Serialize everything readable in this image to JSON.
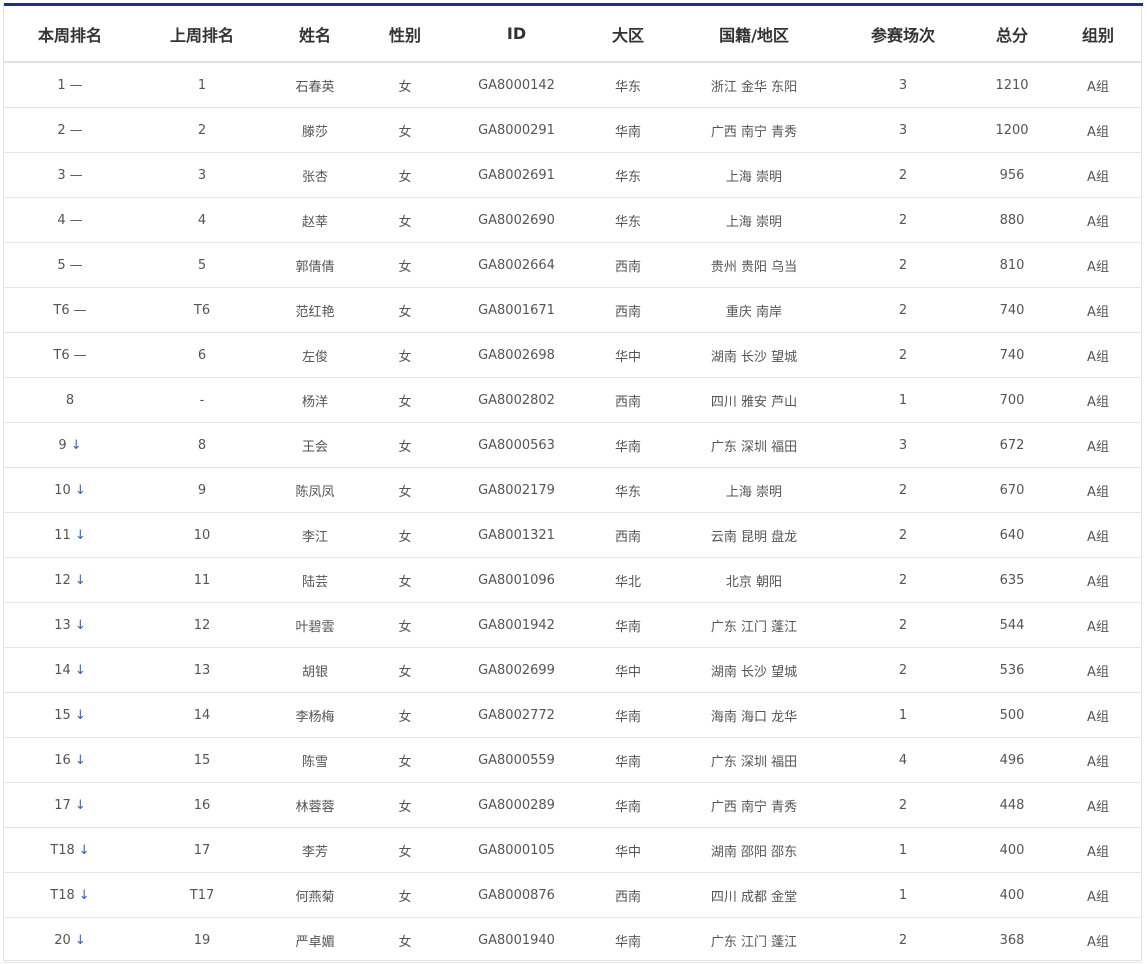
{
  "colors": {
    "top_bar": "#1c3185",
    "down_arrow": "#2b5fd9"
  },
  "headers": [
    "本周排名",
    "上周排名",
    "姓名",
    "性别",
    "ID",
    "大区",
    "国籍/地区",
    "参赛场次",
    "总分",
    "组别"
  ],
  "rows": [
    {
      "rank": "1",
      "trend": "—",
      "last": "1",
      "name": "石春英",
      "gender": "女",
      "id": "GA8000142",
      "region": "华东",
      "location": "浙江 金华 东阳",
      "games": "3",
      "score": "1210",
      "group": "A组"
    },
    {
      "rank": "2",
      "trend": "—",
      "last": "2",
      "name": "滕莎",
      "gender": "女",
      "id": "GA8000291",
      "region": "华南",
      "location": "广西 南宁 青秀",
      "games": "3",
      "score": "1200",
      "group": "A组"
    },
    {
      "rank": "3",
      "trend": "—",
      "last": "3",
      "name": "张杏",
      "gender": "女",
      "id": "GA8002691",
      "region": "华东",
      "location": "上海 崇明",
      "games": "2",
      "score": "956",
      "group": "A组"
    },
    {
      "rank": "4",
      "trend": "—",
      "last": "4",
      "name": "赵莘",
      "gender": "女",
      "id": "GA8002690",
      "region": "华东",
      "location": "上海 崇明",
      "games": "2",
      "score": "880",
      "group": "A组"
    },
    {
      "rank": "5",
      "trend": "—",
      "last": "5",
      "name": "郭倩倩",
      "gender": "女",
      "id": "GA8002664",
      "region": "西南",
      "location": "贵州 贵阳 乌当",
      "games": "2",
      "score": "810",
      "group": "A组"
    },
    {
      "rank": "T6",
      "trend": "—",
      "last": "T6",
      "name": "范红艳",
      "gender": "女",
      "id": "GA8001671",
      "region": "西南",
      "location": "重庆 南岸",
      "games": "2",
      "score": "740",
      "group": "A组"
    },
    {
      "rank": "T6",
      "trend": "—",
      "last": "6",
      "name": "左俊",
      "gender": "女",
      "id": "GA8002698",
      "region": "华中",
      "location": "湖南 长沙 望城",
      "games": "2",
      "score": "740",
      "group": "A组"
    },
    {
      "rank": "8",
      "trend": "",
      "last": "-",
      "name": "杨洋",
      "gender": "女",
      "id": "GA8002802",
      "region": "西南",
      "location": "四川 雅安 芦山",
      "games": "1",
      "score": "700",
      "group": "A组"
    },
    {
      "rank": "9",
      "trend": "↓",
      "last": "8",
      "name": "王会",
      "gender": "女",
      "id": "GA8000563",
      "region": "华南",
      "location": "广东 深圳 福田",
      "games": "3",
      "score": "672",
      "group": "A组"
    },
    {
      "rank": "10",
      "trend": "↓",
      "last": "9",
      "name": "陈凤凤",
      "gender": "女",
      "id": "GA8002179",
      "region": "华东",
      "location": "上海 崇明",
      "games": "2",
      "score": "670",
      "group": "A组"
    },
    {
      "rank": "11",
      "trend": "↓",
      "last": "10",
      "name": "李江",
      "gender": "女",
      "id": "GA8001321",
      "region": "西南",
      "location": "云南 昆明 盘龙",
      "games": "2",
      "score": "640",
      "group": "A组"
    },
    {
      "rank": "12",
      "trend": "↓",
      "last": "11",
      "name": "陆芸",
      "gender": "女",
      "id": "GA8001096",
      "region": "华北",
      "location": "北京 朝阳",
      "games": "2",
      "score": "635",
      "group": "A组"
    },
    {
      "rank": "13",
      "trend": "↓",
      "last": "12",
      "name": "叶碧雲",
      "gender": "女",
      "id": "GA8001942",
      "region": "华南",
      "location": "广东 江门 蓬江",
      "games": "2",
      "score": "544",
      "group": "A组"
    },
    {
      "rank": "14",
      "trend": "↓",
      "last": "13",
      "name": "胡银",
      "gender": "女",
      "id": "GA8002699",
      "region": "华中",
      "location": "湖南 长沙 望城",
      "games": "2",
      "score": "536",
      "group": "A组"
    },
    {
      "rank": "15",
      "trend": "↓",
      "last": "14",
      "name": "李杨梅",
      "gender": "女",
      "id": "GA8002772",
      "region": "华南",
      "location": "海南 海口 龙华",
      "games": "1",
      "score": "500",
      "group": "A组"
    },
    {
      "rank": "16",
      "trend": "↓",
      "last": "15",
      "name": "陈雪",
      "gender": "女",
      "id": "GA8000559",
      "region": "华南",
      "location": "广东 深圳 福田",
      "games": "4",
      "score": "496",
      "group": "A组"
    },
    {
      "rank": "17",
      "trend": "↓",
      "last": "16",
      "name": "林蓉蓉",
      "gender": "女",
      "id": "GA8000289",
      "region": "华南",
      "location": "广西 南宁 青秀",
      "games": "2",
      "score": "448",
      "group": "A组"
    },
    {
      "rank": "T18",
      "trend": "↓",
      "last": "17",
      "name": "李芳",
      "gender": "女",
      "id": "GA8000105",
      "region": "华中",
      "location": "湖南 邵阳 邵东",
      "games": "1",
      "score": "400",
      "group": "A组"
    },
    {
      "rank": "T18",
      "trend": "↓",
      "last": "T17",
      "name": "何燕菊",
      "gender": "女",
      "id": "GA8000876",
      "region": "西南",
      "location": "四川 成都 金堂",
      "games": "1",
      "score": "400",
      "group": "A组"
    },
    {
      "rank": "20",
      "trend": "↓",
      "last": "19",
      "name": "严卓媚",
      "gender": "女",
      "id": "GA8001940",
      "region": "华南",
      "location": "广东 江门 蓬江",
      "games": "2",
      "score": "368",
      "group": "A组"
    }
  ]
}
